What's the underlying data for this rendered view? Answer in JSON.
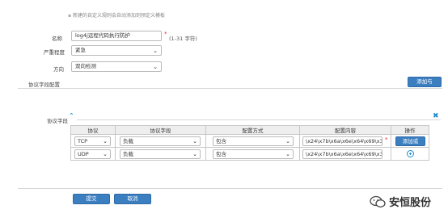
{
  "form": {
    "hint": "新建的自定义规则会自动添加到预定义模板",
    "name_label": "名称",
    "name_value": "log4j远程代码执行防护",
    "name_required_mark": "*",
    "name_length_hint": "(1-31 字符)",
    "severity_label": "严重程度",
    "severity_value": "紧急",
    "direction_label": "方向",
    "direction_value": "双向检测",
    "protocol_config_label": "协议字段配置",
    "add_button": "添加与",
    "protocol_field_label": "协议字段",
    "submit_button": "提交",
    "cancel_button": "取消"
  },
  "table": {
    "headers": [
      "协议",
      "协议字段",
      "配置方式",
      "配置内容",
      "操作"
    ],
    "rows": [
      {
        "protocol": "TCP",
        "field": "负载",
        "method": "包含",
        "content": "\\x24\\x7b\\x6a\\x6e\\x64\\x69\\x3a",
        "required_mark": "*",
        "action": "添加或"
      },
      {
        "protocol": "UDP",
        "field": "负载",
        "method": "包含",
        "content": "\\x24\\x7b\\x6a\\x6e\\x64\\x69\\x3a",
        "required_mark": "",
        "action": ""
      }
    ]
  },
  "icons": {
    "collapse": "chevron-up-icon",
    "close": "close-icon",
    "add_row": "plus-circle-icon",
    "info": "info-icon",
    "watermark": "wechat-icon"
  },
  "watermark": {
    "text": "安恒股份"
  },
  "colors": {
    "primary_button": "#3c7fc1",
    "required": "#e22233",
    "icon_blue": "#1a8bd1"
  }
}
